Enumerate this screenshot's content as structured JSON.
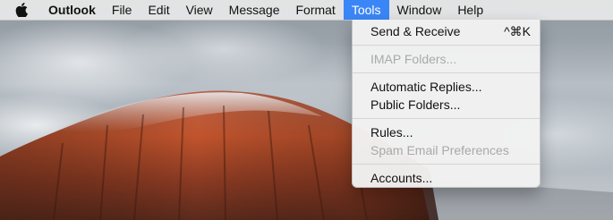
{
  "menubar": {
    "apple_icon": "apple-logo-icon",
    "app_name": "Outlook",
    "items": [
      "File",
      "Edit",
      "View",
      "Message",
      "Format",
      "Tools",
      "Window",
      "Help"
    ],
    "active_item": "Tools"
  },
  "tools_menu": {
    "send_receive": {
      "label": "Send & Receive",
      "shortcut": "^⌘K"
    },
    "imap_folders": {
      "label": "IMAP Folders...",
      "enabled": false
    },
    "automatic_replies": {
      "label": "Automatic Replies..."
    },
    "public_folders": {
      "label": "Public Folders..."
    },
    "rules": {
      "label": "Rules..."
    },
    "spam_prefs": {
      "label": "Spam Email Preferences",
      "enabled": false
    },
    "accounts": {
      "label": "Accounts..."
    }
  },
  "colors": {
    "menu_highlight": "#3b86f7",
    "disabled_text": "#a9a9a9"
  }
}
